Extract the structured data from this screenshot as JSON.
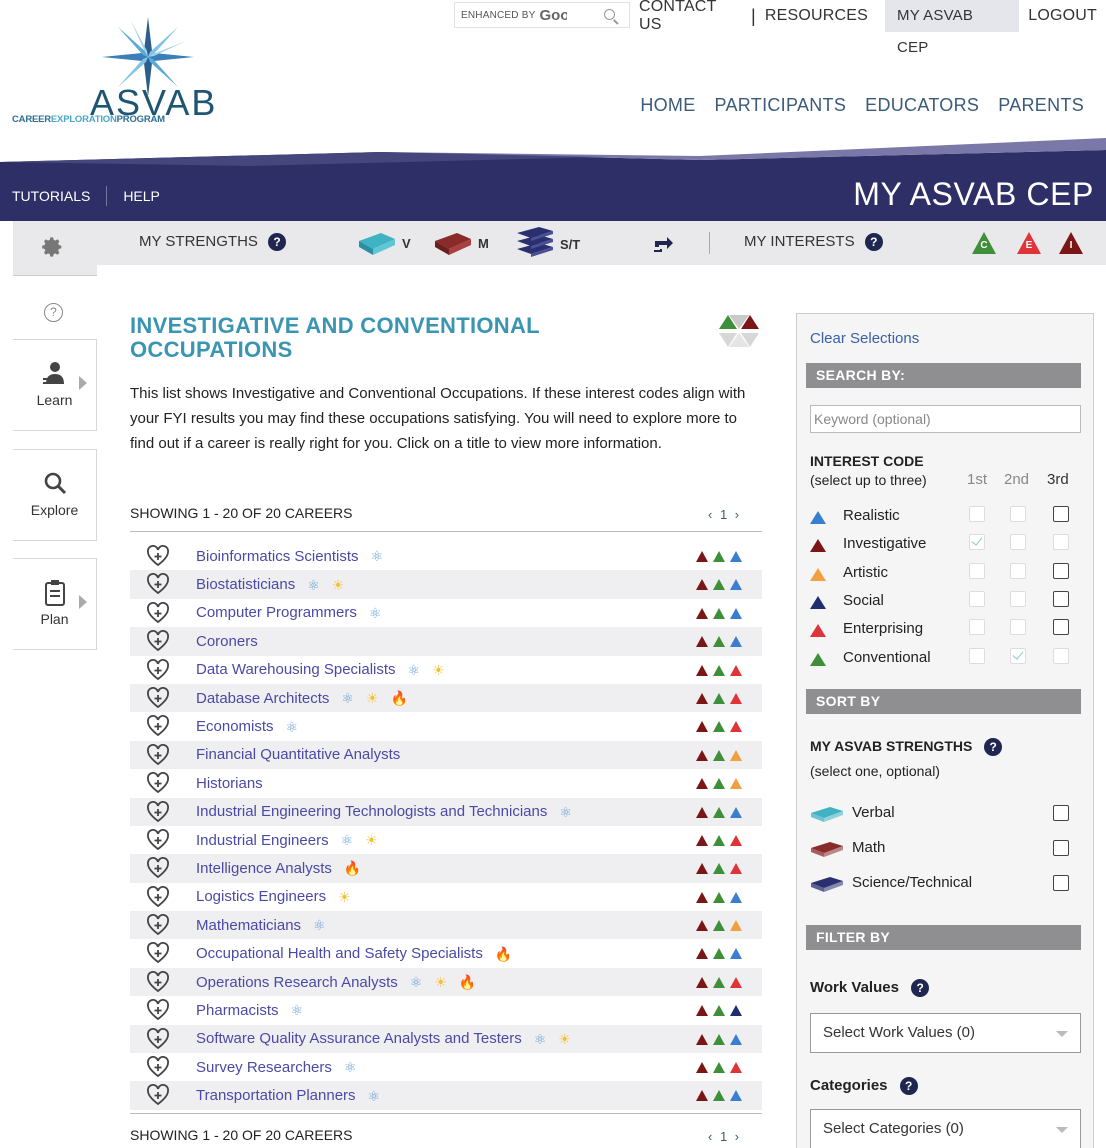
{
  "topbar": {
    "enhanced_by": "ENHANCED BY",
    "google": "Google",
    "links": [
      "CONTACT US",
      "RESOURCES"
    ],
    "separator": "|",
    "my_asvab_cep": "MY ASVAB CEP",
    "logout": "LOGOUT"
  },
  "logo": {
    "name": "ASVAB",
    "tagline_a": "CAREER",
    "tagline_b": "EXPLORATION",
    "tagline_c": "PROGRAM"
  },
  "mainnav": [
    "HOME",
    "PARTICIPANTS",
    "EDUCATORS",
    "PARENTS"
  ],
  "banner": {
    "tutorials": "TUTORIALS",
    "help": "HELP",
    "title": "MY ASVAB CEP"
  },
  "strengths_bar": {
    "strengths_label": "MY STRENGTHS",
    "verbal": "V",
    "math": "M",
    "science": "S/T",
    "interests_label": "MY INTERESTS",
    "interest_codes": [
      "C",
      "E",
      "I"
    ],
    "interest_colors": [
      "#3f8f3a",
      "#e0333a",
      "#7a1616"
    ]
  },
  "rail": {
    "help_glyph": "?",
    "learn": "Learn",
    "explore": "Explore",
    "plan": "Plan"
  },
  "main": {
    "title": "INVESTIGATIVE AND CONVENTIONAL OCCUPATIONS",
    "intro": "This list shows Investigative and Conventional Occupations. If these interest codes align with your FYI results you may find these occupations satisfying. You will need to explore more to find out if a career is really right for you. Click on a title to view more information.",
    "showing": "SHOWING 1 - 20 OF 20 CAREERS",
    "pager": "‹ 1 ›",
    "careers": [
      {
        "title": "Bioinformatics Scientists",
        "badges": [
          "atom"
        ],
        "codes": [
          "I",
          "C",
          "R"
        ]
      },
      {
        "title": "Biostatisticians",
        "badges": [
          "atom",
          "sun"
        ],
        "codes": [
          "I",
          "C",
          "R"
        ]
      },
      {
        "title": "Computer Programmers",
        "badges": [
          "atom"
        ],
        "codes": [
          "I",
          "C",
          "R"
        ]
      },
      {
        "title": "Coroners",
        "badges": [],
        "codes": [
          "I",
          "C",
          "R"
        ]
      },
      {
        "title": "Data Warehousing Specialists",
        "badges": [
          "atom",
          "sun"
        ],
        "codes": [
          "I",
          "C",
          "E"
        ]
      },
      {
        "title": "Database Architects",
        "badges": [
          "atom",
          "sun",
          "fire"
        ],
        "codes": [
          "I",
          "C",
          "E"
        ]
      },
      {
        "title": "Economists",
        "badges": [
          "atom"
        ],
        "codes": [
          "I",
          "C",
          "E"
        ]
      },
      {
        "title": "Financial Quantitative Analysts",
        "badges": [],
        "codes": [
          "I",
          "C",
          "A"
        ]
      },
      {
        "title": "Historians",
        "badges": [],
        "codes": [
          "I",
          "C",
          "A"
        ]
      },
      {
        "title": "Industrial Engineering Technologists and Technicians",
        "badges": [
          "atom"
        ],
        "codes": [
          "I",
          "C",
          "R"
        ]
      },
      {
        "title": "Industrial Engineers",
        "badges": [
          "atom",
          "sun"
        ],
        "codes": [
          "I",
          "C",
          "E"
        ]
      },
      {
        "title": "Intelligence Analysts",
        "badges": [
          "fire"
        ],
        "codes": [
          "I",
          "C",
          "E"
        ]
      },
      {
        "title": "Logistics Engineers",
        "badges": [
          "sun"
        ],
        "codes": [
          "I",
          "C",
          "R"
        ]
      },
      {
        "title": "Mathematicians",
        "badges": [
          "atom"
        ],
        "codes": [
          "I",
          "C",
          "A"
        ]
      },
      {
        "title": "Occupational Health and Safety Specialists",
        "badges": [
          "fire"
        ],
        "codes": [
          "I",
          "C",
          "R"
        ]
      },
      {
        "title": "Operations Research Analysts",
        "badges": [
          "atom",
          "sun",
          "fire"
        ],
        "codes": [
          "I",
          "C",
          "E"
        ]
      },
      {
        "title": "Pharmacists",
        "badges": [
          "atom"
        ],
        "codes": [
          "I",
          "C",
          "S"
        ]
      },
      {
        "title": "Software Quality Assurance Analysts and Testers",
        "badges": [
          "atom",
          "sun"
        ],
        "codes": [
          "I",
          "C",
          "R"
        ]
      },
      {
        "title": "Survey Researchers",
        "badges": [
          "atom"
        ],
        "codes": [
          "I",
          "C",
          "E"
        ]
      },
      {
        "title": "Transportation Planners",
        "badges": [
          "atom"
        ],
        "codes": [
          "I",
          "C",
          "R"
        ]
      }
    ]
  },
  "code_colors": {
    "R": "#3a7fcf",
    "I": "#7a1616",
    "A": "#f0a040",
    "S": "#1f2f6e",
    "E": "#e0333a",
    "C": "#3f8f3a"
  },
  "panel": {
    "clear": "Clear Selections",
    "search_by": "SEARCH BY:",
    "keyword_placeholder": "Keyword (optional)",
    "interest_code": "INTEREST CODE",
    "select_up_to": "(select up to three)",
    "order": [
      "1st",
      "2nd",
      "3rd"
    ],
    "interests": [
      {
        "name": "Realistic",
        "code": "R",
        "checks": [
          "dim",
          "dim",
          "on"
        ]
      },
      {
        "name": "Investigative",
        "code": "I",
        "checks": [
          "checked",
          "dim",
          "dim"
        ]
      },
      {
        "name": "Artistic",
        "code": "A",
        "checks": [
          "dim",
          "dim",
          "on"
        ]
      },
      {
        "name": "Social",
        "code": "S",
        "checks": [
          "dim",
          "dim",
          "on"
        ]
      },
      {
        "name": "Enterprising",
        "code": "E",
        "checks": [
          "dim",
          "dim",
          "on"
        ]
      },
      {
        "name": "Conventional",
        "code": "C",
        "checks": [
          "dim",
          "checked",
          "dim"
        ]
      }
    ],
    "sort_by": "SORT BY",
    "my_asvab_strengths": "MY ASVAB STRENGTHS",
    "select_one": "(select one, optional)",
    "strengths": [
      {
        "name": "Verbal",
        "color": "#3fb3c4"
      },
      {
        "name": "Math",
        "color": "#8a2a2a"
      },
      {
        "name": "Science/Technical",
        "color": "#2a2f70"
      }
    ],
    "filter_by": "FILTER BY",
    "work_values": "Work Values",
    "work_values_select": "Select Work Values (0)",
    "categories": "Categories",
    "categories_select": "Select Categories (0)"
  }
}
